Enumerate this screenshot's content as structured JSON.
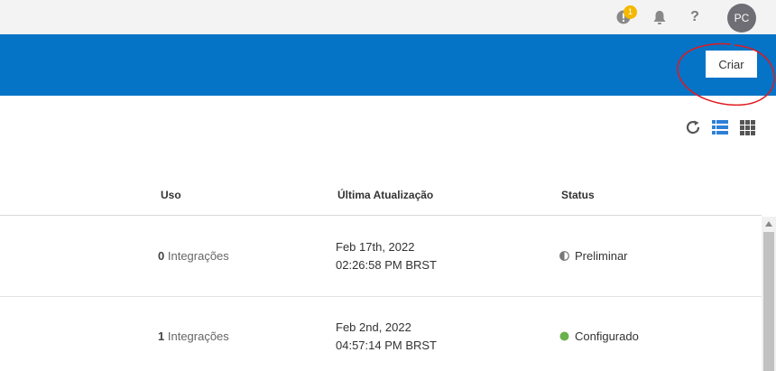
{
  "topbar": {
    "notifications_count": "1",
    "avatar_initials": "PC"
  },
  "header": {
    "create_button_label": "Criar"
  },
  "table": {
    "columns": [
      "Uso",
      "Última Atualização",
      "Status"
    ],
    "rows": [
      {
        "uso_count": "0",
        "uso_label": "Integrações",
        "date": "Feb 17th, 2022",
        "time": "02:26:58 PM BRST",
        "status": "Preliminar",
        "status_icon": "half-circle-icon"
      },
      {
        "uso_count": "1",
        "uso_label": "Integrações",
        "date": "Feb 2nd, 2022",
        "time": "04:57:14 PM BRST",
        "status": "Configurado",
        "status_icon": "green-dot-icon"
      }
    ]
  },
  "colors": {
    "header_blue": "#0574c7",
    "badge": "#f5b800",
    "status_configured": "#6ab04c",
    "annotation_circle": "#e0191f"
  }
}
